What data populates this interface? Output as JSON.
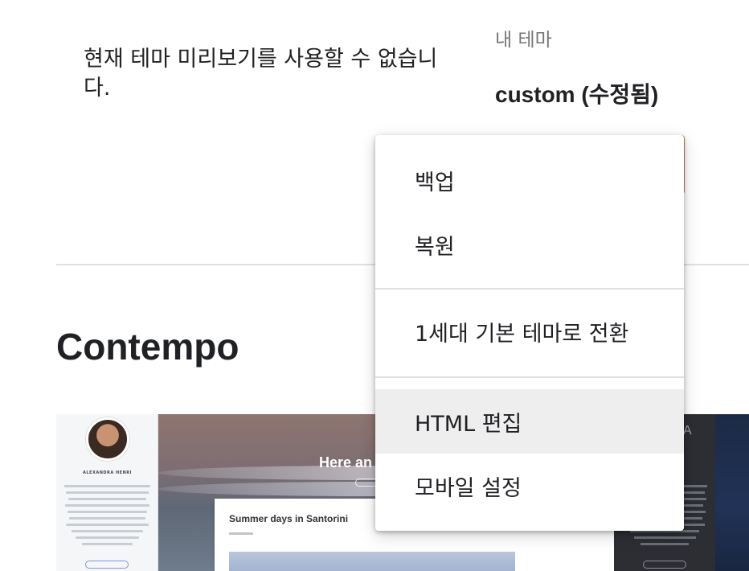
{
  "header": {
    "preview_message": "현재 테마 미리보기를 사용할 수 없습니다.",
    "my_theme_label": "내 테마",
    "my_theme_name": "custom (수정됨)"
  },
  "theme_card": {
    "title": "Contempo",
    "preview": {
      "hero_title": "Here an",
      "author": "ALEXANDRA HENRI",
      "post_title": "Summer days in Santorini",
      "dark_hero_letter": "A"
    }
  },
  "menu": {
    "items": [
      {
        "label": "백업"
      },
      {
        "label": "복원"
      },
      {
        "label": "1세대 기본 테마로 전환"
      },
      {
        "label": "HTML 편집"
      },
      {
        "label": "모바일 설정"
      }
    ],
    "highlighted_item": "HTML 편집"
  },
  "colors": {
    "accent_border": "#c8765b",
    "menu_highlight": "#eeeeee",
    "divider": "#e0e0e0"
  }
}
